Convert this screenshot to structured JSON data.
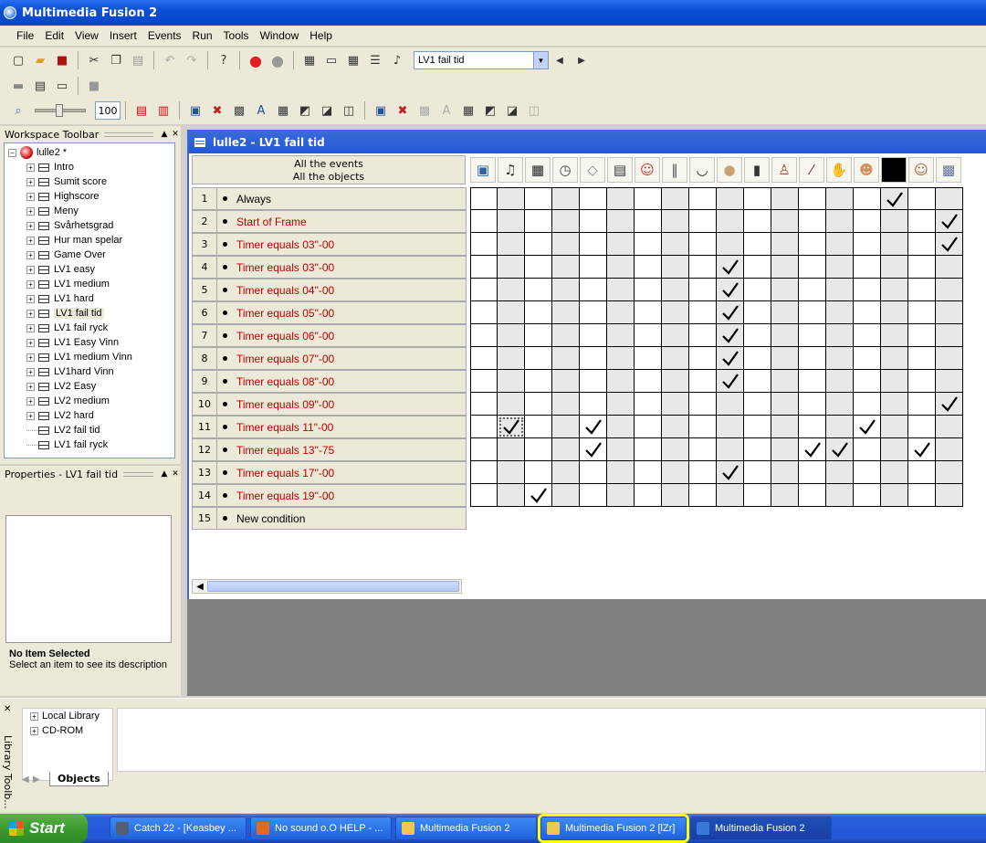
{
  "window": {
    "title": "Multimedia Fusion 2"
  },
  "menu": [
    "File",
    "Edit",
    "View",
    "Insert",
    "Events",
    "Run",
    "Tools",
    "Window",
    "Help"
  ],
  "toolbar": {
    "frame_select": "LV1 fail tid",
    "zoom": "100"
  },
  "workspace": {
    "title": "Workspace Toolbar",
    "root": "lulle2 *",
    "frames": [
      "Intro",
      "Sumit score",
      "Highscore",
      "Meny",
      "Svårhetsgrad",
      "Hur man spelar",
      "Game Over",
      "LV1 easy",
      "LV1 medium",
      "LV1 hard",
      "LV1 fail tid",
      "LV1 fail ryck",
      "LV1 Easy Vinn",
      "LV1 medium Vinn",
      "LV1hard Vinn",
      "LV2 Easy",
      "LV2 medium",
      "LV2 hard",
      "LV2 fail tid",
      "LV1 fail ryck"
    ],
    "selected": "LV1 fail tid"
  },
  "properties": {
    "title": "Properties - LV1 fail tid",
    "desc_title": "No Item Selected",
    "desc_text": "Select an item to see its description"
  },
  "editor": {
    "title": "lulle2 - LV1 fail tid",
    "header_line1": "All the events",
    "header_line2": "All the objects",
    "object_icons": [
      "storyboard-icon",
      "sound-icon",
      "special-icon",
      "timer-icon",
      "create-object-icon",
      "keyboard-icon",
      "player-icon",
      "pants-icon",
      "hat-icon",
      "head-icon",
      "shirt-icon",
      "figure-icon",
      "brush-icon",
      "hand-icon",
      "face-icon",
      "black-square-icon",
      "man-icon",
      "pattern-icon"
    ],
    "events": [
      {
        "num": "1",
        "text": "Always",
        "red": false,
        "checks": [
          15
        ]
      },
      {
        "num": "2",
        "text": "Start of Frame",
        "red": true,
        "checks": [
          17
        ]
      },
      {
        "num": "3",
        "text": "Timer equals 03\"-00",
        "red": true,
        "checks": [
          17
        ]
      },
      {
        "num": "4",
        "text": "Timer equals 03\"-00",
        "red": true,
        "checks": [
          9
        ]
      },
      {
        "num": "5",
        "text": "Timer equals 04\"-00",
        "red": true,
        "checks": [
          9
        ]
      },
      {
        "num": "6",
        "text": "Timer equals 05\"-00",
        "red": true,
        "checks": [
          9
        ]
      },
      {
        "num": "7",
        "text": "Timer equals 06\"-00",
        "red": true,
        "checks": [
          9
        ]
      },
      {
        "num": "8",
        "text": "Timer equals 07\"-00",
        "red": true,
        "checks": [
          9
        ]
      },
      {
        "num": "9",
        "text": "Timer equals 08\"-00",
        "red": true,
        "checks": [
          9
        ]
      },
      {
        "num": "10",
        "text": "Timer equals 09\"-00",
        "red": true,
        "checks": [
          17
        ]
      },
      {
        "num": "11",
        "text": "Timer equals 11\"-00",
        "red": true,
        "checks": [
          1,
          4,
          14
        ]
      },
      {
        "num": "12",
        "text": "Timer equals 13\"-75",
        "red": true,
        "checks": [
          4,
          12,
          13,
          16
        ]
      },
      {
        "num": "13",
        "text": "Timer equals 17\"-00",
        "red": true,
        "checks": [
          9
        ]
      },
      {
        "num": "14",
        "text": "Timer equals 19\"-00",
        "red": true,
        "checks": [
          2
        ]
      },
      {
        "num": "15",
        "text": "New condition",
        "red": false,
        "checks": []
      }
    ],
    "grid_columns": 18,
    "selected_cell": {
      "row": 11,
      "col": 1
    }
  },
  "library": {
    "title": "Library Toolb...",
    "items": [
      "Local Library",
      "CD-ROM"
    ],
    "tab": "Objects"
  },
  "taskbar": {
    "start": "Start",
    "buttons": [
      {
        "label": "Catch 22 - [Keasbey ...",
        "color": "#506070"
      },
      {
        "label": "No sound o.O HELP - ...",
        "color": "#e06a1c"
      },
      {
        "label": "Multimedia Fusion 2",
        "color": "#f0c850"
      },
      {
        "label": "Multimedia Fusion 2 [lZr]",
        "color": "#f0c850"
      },
      {
        "label": "Multimedia Fusion 2",
        "color": "#3a78d8"
      }
    ]
  }
}
